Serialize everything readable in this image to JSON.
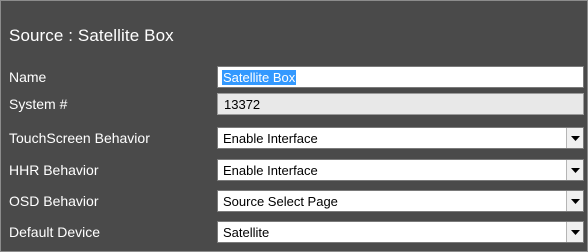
{
  "panel": {
    "title": "Source : Satellite Box"
  },
  "fields": {
    "name": {
      "label": "Name",
      "value": "Satellite Box"
    },
    "system_number": {
      "label": "System #",
      "value": "13372"
    },
    "touchscreen_behavior": {
      "label": "TouchScreen Behavior",
      "value": "Enable Interface"
    },
    "hhr_behavior": {
      "label": "HHR Behavior",
      "value": "Enable Interface"
    },
    "osd_behavior": {
      "label": "OSD Behavior",
      "value": "Source Select Page"
    },
    "default_device": {
      "label": "Default Device",
      "value": "Satellite"
    }
  },
  "icons": {
    "dropdown": "chevron-down-icon"
  },
  "colors": {
    "panel_background": "#4a4a4a",
    "selection_highlight": "#3399ff",
    "readonly_background": "#e8e8e8"
  }
}
